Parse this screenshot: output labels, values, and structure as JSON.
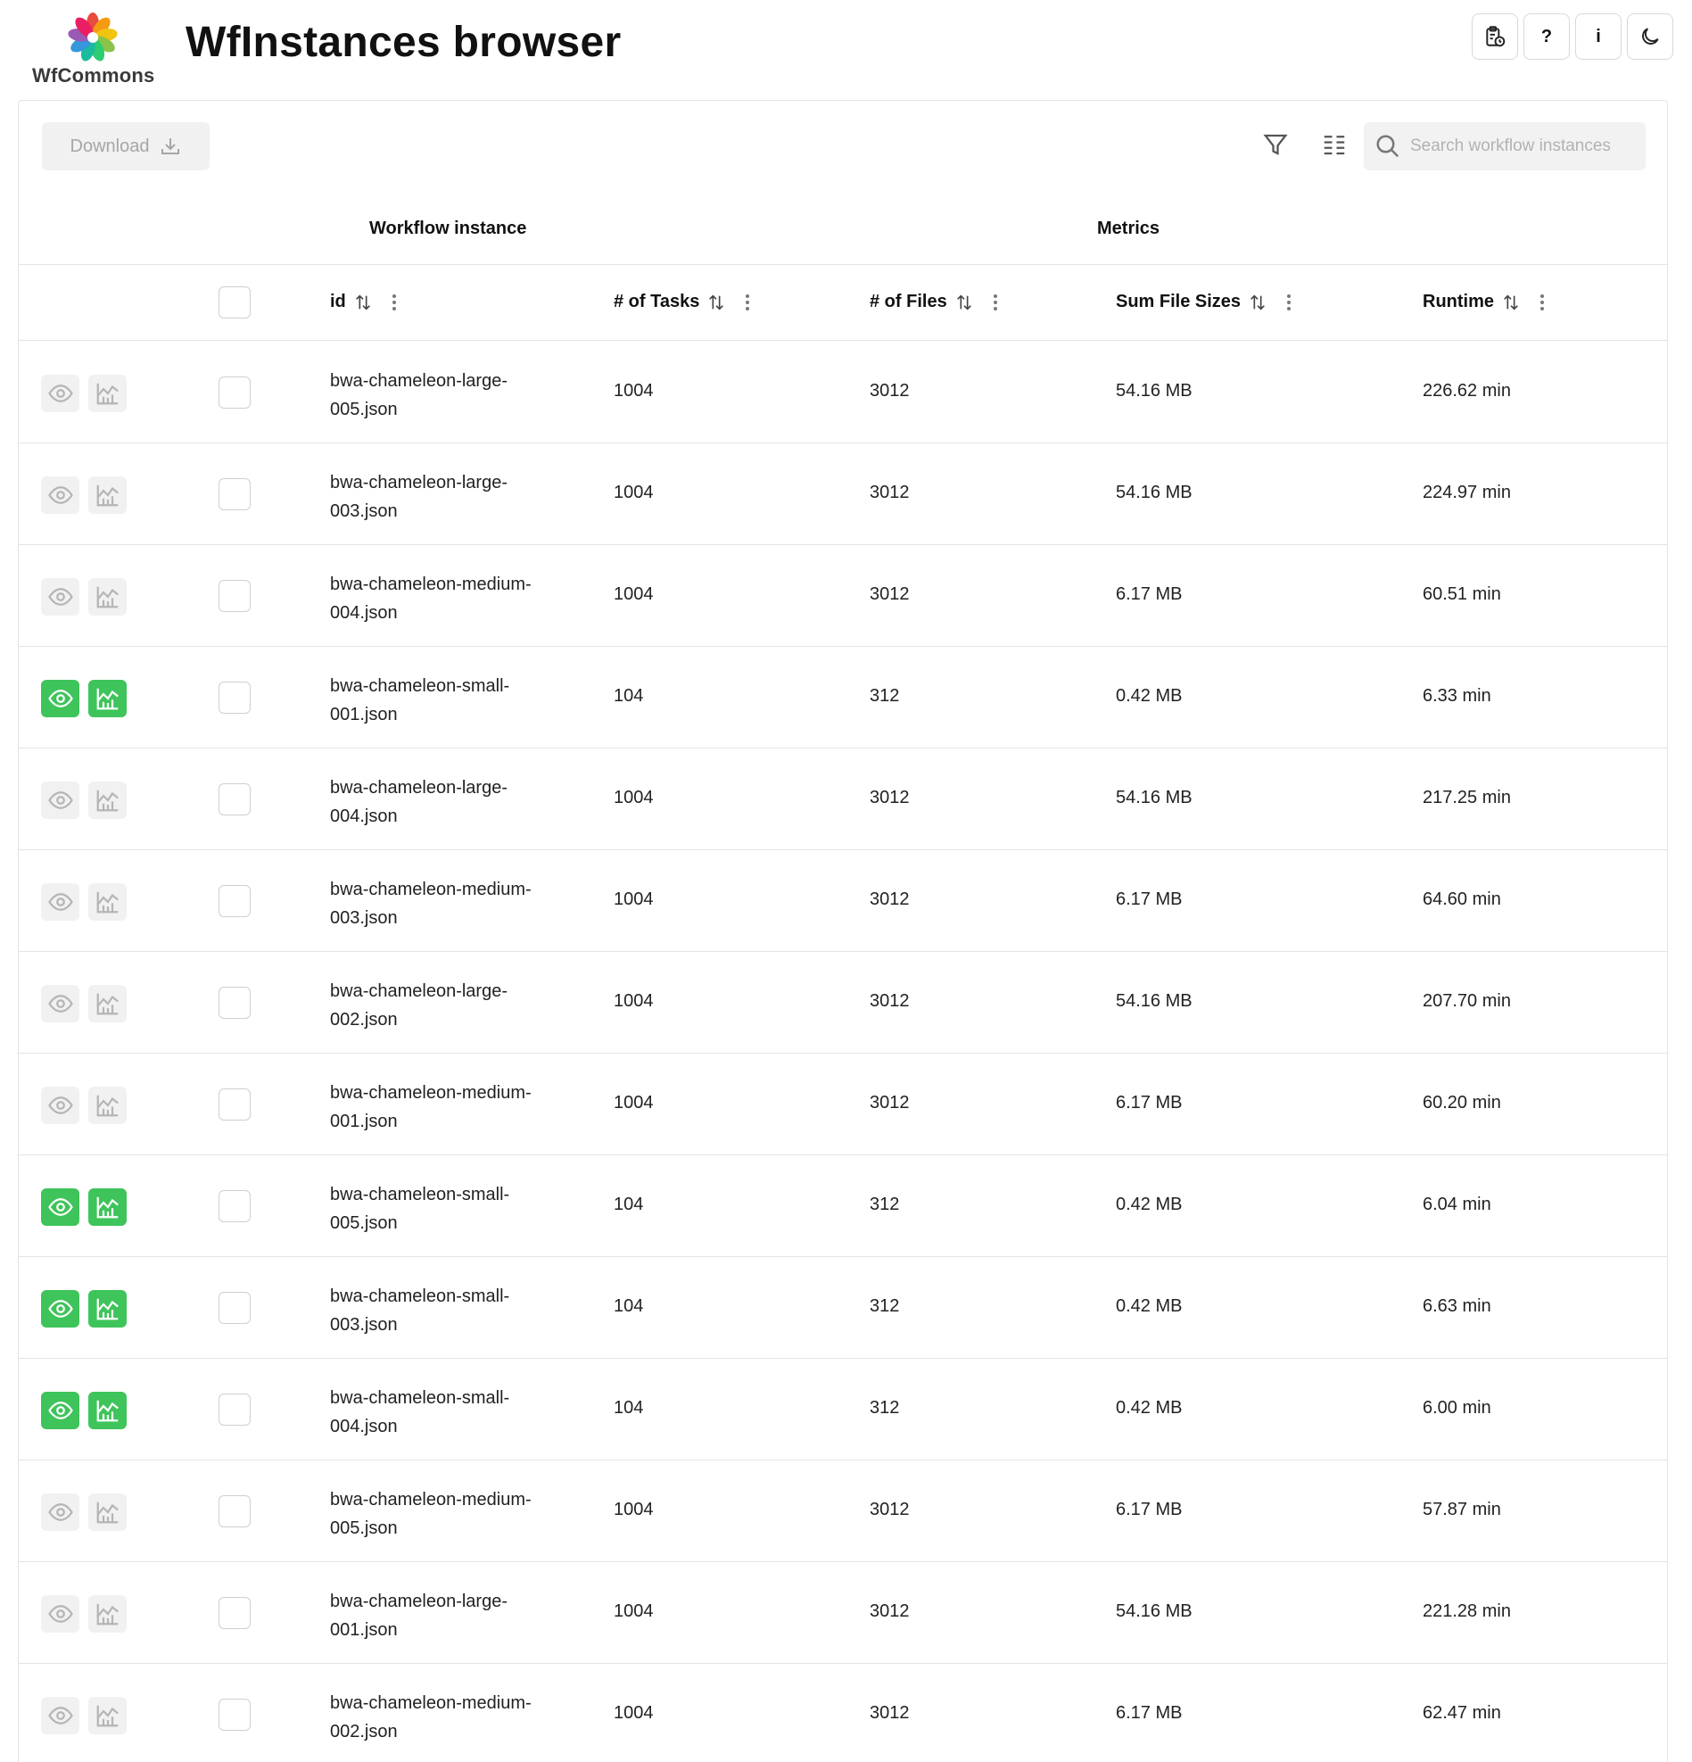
{
  "app": {
    "logo_text": "WfCommons",
    "title": "WfInstances browser"
  },
  "header_buttons": [
    {
      "icon": "clipboard-clock-icon"
    },
    {
      "icon": "help-icon",
      "glyph": "?"
    },
    {
      "icon": "info-icon",
      "glyph": "i"
    },
    {
      "icon": "moon-icon"
    }
  ],
  "toolbar": {
    "download_label": "Download",
    "search_placeholder": "Search workflow instances"
  },
  "groups": {
    "workflow_instance": "Workflow instance",
    "metrics": "Metrics"
  },
  "columns": {
    "id": "id",
    "tasks": "# of Tasks",
    "files": "# of Files",
    "sizes": "Sum File Sizes",
    "runtime": "Runtime"
  },
  "colors": {
    "active_green": "#3ec45a",
    "inactive_gray": "#f1f1f1"
  },
  "rows": [
    {
      "id_line1": "bwa-chameleon-large-",
      "id_line2": "005.json",
      "tasks": "1004",
      "files": "3012",
      "size": "54.16 MB",
      "runtime": "226.62 min",
      "active": false
    },
    {
      "id_line1": "bwa-chameleon-large-",
      "id_line2": "003.json",
      "tasks": "1004",
      "files": "3012",
      "size": "54.16 MB",
      "runtime": "224.97 min",
      "active": false
    },
    {
      "id_line1": "bwa-chameleon-medium-",
      "id_line2": "004.json",
      "tasks": "1004",
      "files": "3012",
      "size": "6.17 MB",
      "runtime": "60.51 min",
      "active": false
    },
    {
      "id_line1": "bwa-chameleon-small-",
      "id_line2": "001.json",
      "tasks": "104",
      "files": "312",
      "size": "0.42 MB",
      "runtime": "6.33 min",
      "active": true
    },
    {
      "id_line1": "bwa-chameleon-large-",
      "id_line2": "004.json",
      "tasks": "1004",
      "files": "3012",
      "size": "54.16 MB",
      "runtime": "217.25 min",
      "active": false
    },
    {
      "id_line1": "bwa-chameleon-medium-",
      "id_line2": "003.json",
      "tasks": "1004",
      "files": "3012",
      "size": "6.17 MB",
      "runtime": "64.60 min",
      "active": false
    },
    {
      "id_line1": "bwa-chameleon-large-",
      "id_line2": "002.json",
      "tasks": "1004",
      "files": "3012",
      "size": "54.16 MB",
      "runtime": "207.70 min",
      "active": false
    },
    {
      "id_line1": "bwa-chameleon-medium-",
      "id_line2": "001.json",
      "tasks": "1004",
      "files": "3012",
      "size": "6.17 MB",
      "runtime": "60.20 min",
      "active": false
    },
    {
      "id_line1": "bwa-chameleon-small-",
      "id_line2": "005.json",
      "tasks": "104",
      "files": "312",
      "size": "0.42 MB",
      "runtime": "6.04 min",
      "active": true
    },
    {
      "id_line1": "bwa-chameleon-small-",
      "id_line2": "003.json",
      "tasks": "104",
      "files": "312",
      "size": "0.42 MB",
      "runtime": "6.63 min",
      "active": true
    },
    {
      "id_line1": "bwa-chameleon-small-",
      "id_line2": "004.json",
      "tasks": "104",
      "files": "312",
      "size": "0.42 MB",
      "runtime": "6.00 min",
      "active": true
    },
    {
      "id_line1": "bwa-chameleon-medium-",
      "id_line2": "005.json",
      "tasks": "1004",
      "files": "3012",
      "size": "6.17 MB",
      "runtime": "57.87 min",
      "active": false
    },
    {
      "id_line1": "bwa-chameleon-large-",
      "id_line2": "001.json",
      "tasks": "1004",
      "files": "3012",
      "size": "54.16 MB",
      "runtime": "221.28 min",
      "active": false
    },
    {
      "id_line1": "bwa-chameleon-medium-",
      "id_line2": "002.json",
      "tasks": "1004",
      "files": "3012",
      "size": "6.17 MB",
      "runtime": "62.47 min",
      "active": false
    }
  ]
}
